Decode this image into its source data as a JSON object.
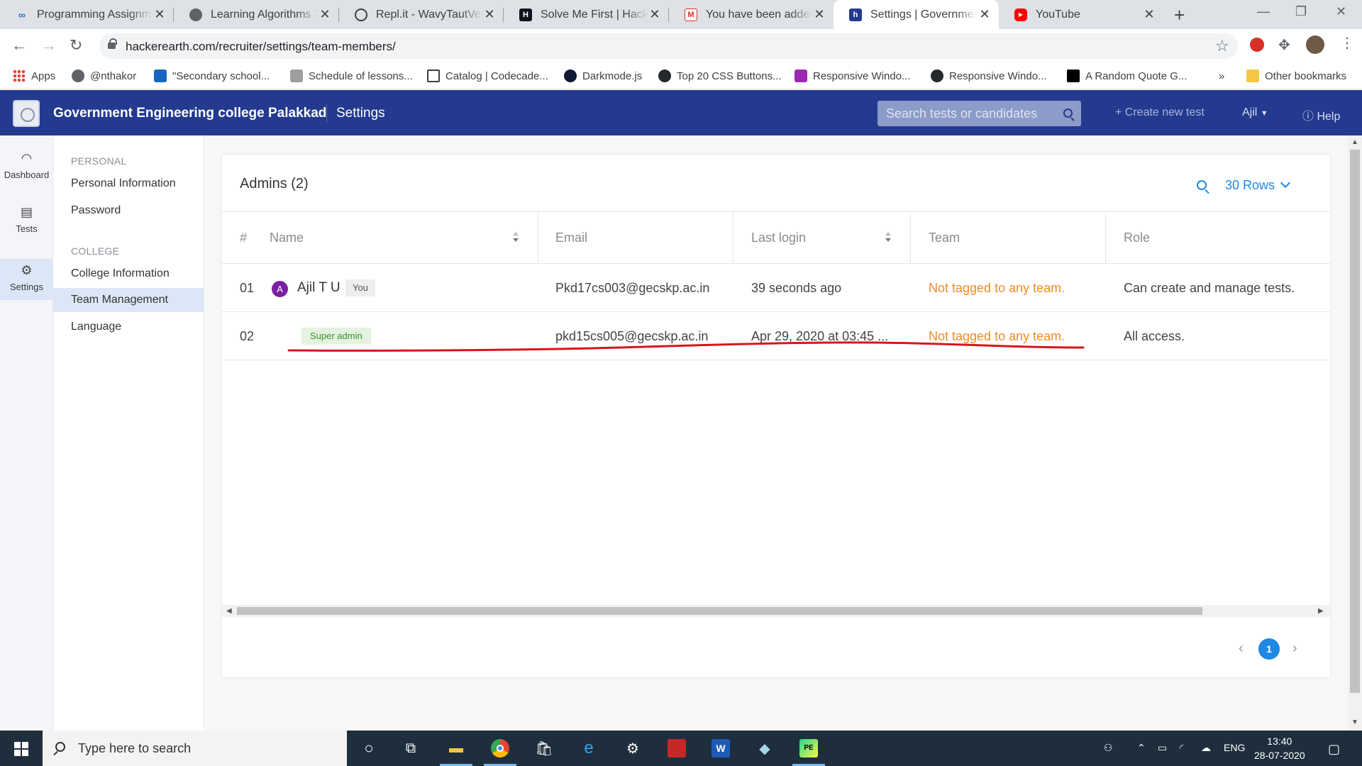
{
  "browser": {
    "tabs": [
      {
        "title": "Programming Assignm",
        "favicon": "coursera-icon",
        "color": "#2a73cc"
      },
      {
        "title": "Learning Algorithms Th",
        "favicon": "globe-icon",
        "color": "#5f6368"
      },
      {
        "title": "Repl.it - WavyTautVerifi",
        "favicon": "replit-icon",
        "color": "#3c4043"
      },
      {
        "title": "Solve Me First | Hacker",
        "favicon": "hackerrank-icon",
        "color": "#0e141e"
      },
      {
        "title": "You have been added a",
        "favicon": "gmail-icon",
        "color": "#d93025"
      },
      {
        "title": "Settings | Government",
        "favicon": "hackerearth-icon",
        "color": "#233a8f",
        "active": true
      },
      {
        "title": "YouTube",
        "favicon": "youtube-icon",
        "color": "#ff0000"
      }
    ],
    "url": "hackerearth.com/recruiter/settings/team-members/",
    "bookmarks": [
      {
        "label": "Apps",
        "icon": "apps-grid-icon"
      },
      {
        "label": "@nthakor",
        "icon": "globe-icon"
      },
      {
        "label": "\"Secondary school...",
        "icon": "site-icon"
      },
      {
        "label": "Schedule of lessons...",
        "icon": "site-icon"
      },
      {
        "label": "Catalog | Codecade...",
        "icon": "codecademy-icon"
      },
      {
        "label": "Darkmode.js",
        "icon": "dot-icon"
      },
      {
        "label": "Top 20 CSS Buttons...",
        "icon": "github-icon"
      },
      {
        "label": "Responsive Windo...",
        "icon": "site-icon"
      },
      {
        "label": "Responsive Windo...",
        "icon": "github-icon"
      },
      {
        "label": "A Random Quote G...",
        "icon": "dev-icon"
      }
    ],
    "overflow_label": "»",
    "other_bookmarks": "Other bookmarks"
  },
  "header": {
    "college": "Government Engineering college Palakkad",
    "section": "Settings",
    "search_placeholder": "Search tests or candidates",
    "create_test": "+ Create new test",
    "user": "Ajil",
    "help": "Help"
  },
  "rail": [
    {
      "label": "Dashboard",
      "icon": "gauge-icon"
    },
    {
      "label": "Tests",
      "icon": "clipboard-icon"
    },
    {
      "label": "Settings",
      "icon": "gear-icon",
      "active": true
    }
  ],
  "settings_nav": {
    "personal_heading": "PERSONAL",
    "personal_items": [
      "Personal Information",
      "Password"
    ],
    "college_heading": "COLLEGE",
    "college_items": [
      "College Information",
      "Team Management",
      "Language"
    ],
    "active": "Team Management"
  },
  "admins": {
    "title": "Admins (2)",
    "rows_label": "30 Rows",
    "columns": [
      "#",
      "Name",
      "Email",
      "Last login",
      "Team",
      "Role"
    ],
    "rows": [
      {
        "num": "01",
        "avatar": "A",
        "name": "Ajil T U",
        "badge": "You",
        "email": "Pkd17cs003@gecskp.ac.in",
        "last_login": "39 seconds ago",
        "team": "Not tagged to any team.",
        "role": "Can create and manage tests."
      },
      {
        "num": "02",
        "avatar": "",
        "name": "",
        "badge": "Super admin",
        "email": "pkd15cs005@gecskp.ac.in",
        "last_login": "Apr 29, 2020 at 03:45 ...",
        "team": "Not tagged to any team.",
        "role": "All access."
      }
    ],
    "current_page": "1"
  },
  "taskbar": {
    "search_placeholder": "Type here to search",
    "language": "ENG",
    "time": "13:40",
    "date": "28-07-2020"
  },
  "colors": {
    "header_bg": "#233a8f",
    "accent": "#1e88e5",
    "team_warning": "#f08c24",
    "super_admin_badge": "#3d8f31",
    "annotation_red": "#d9141b"
  }
}
